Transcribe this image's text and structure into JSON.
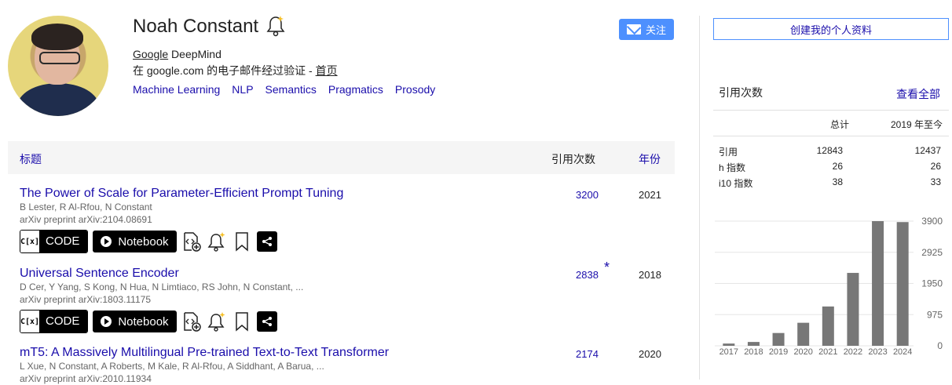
{
  "profile": {
    "name": "Noah Constant",
    "affiliation_link": "Google",
    "affiliation_rest": " DeepMind",
    "verified_prefix": "在 google.com 的电子邮件经过验证 - ",
    "homepage_label": "首页",
    "interests": [
      "Machine Learning",
      "NLP",
      "Semantics",
      "Pragmatics",
      "Prosody"
    ],
    "follow_label": "关注"
  },
  "table": {
    "col_title": "标题",
    "col_cites": "引用次数",
    "col_year": "年份"
  },
  "articles": [
    {
      "title": "The Power of Scale for Parameter-Efficient Prompt Tuning",
      "authors": "B Lester, R Al-Rfou, N Constant",
      "venue": "arXiv preprint arXiv:2104.08691",
      "cites": "3200",
      "year": "2021",
      "star": "",
      "code_label": "CODE",
      "notebook_label": "Notebook"
    },
    {
      "title": "Universal Sentence Encoder",
      "authors": "D Cer, Y Yang, S Kong, N Hua, N Limtiaco, RS John, N Constant, ...",
      "venue": "arXiv preprint arXiv:1803.11175",
      "cites": "2838",
      "year": "2018",
      "star": "*",
      "code_label": "CODE",
      "notebook_label": "Notebook"
    },
    {
      "title": "mT5: A Massively Multilingual Pre-trained Text-to-Text Transformer",
      "authors": "L Xue, N Constant, A Roberts, M Kale, R Al-Rfou, A Siddhant, A Barua, ...",
      "venue": "arXiv preprint arXiv:2010.11934",
      "cites": "2174",
      "year": "2020",
      "star": ""
    }
  ],
  "code_logo": "C[x]",
  "sidebar": {
    "create_profile_label": "创建我的个人资料",
    "cited_by_title": "引用次数",
    "view_all_label": "查看全部",
    "col_total": "总计",
    "col_since": "2019 年至今",
    "rows": [
      {
        "label": "引用",
        "total": "12843",
        "since": "12437"
      },
      {
        "label": "h 指数",
        "total": "26",
        "since": "26"
      },
      {
        "label": "i10 指数",
        "total": "38",
        "since": "33"
      }
    ]
  },
  "chart_data": {
    "type": "bar",
    "categories": [
      "2017",
      "2018",
      "2019",
      "2020",
      "2021",
      "2022",
      "2023",
      "2024"
    ],
    "values": [
      70,
      120,
      400,
      720,
      1230,
      2280,
      3900,
      3870
    ],
    "yticks": [
      "0",
      "975",
      "1950",
      "2925",
      "3900"
    ],
    "ylim": [
      0,
      3900
    ],
    "grid": true,
    "bar_color": "#777777"
  },
  "colors": {
    "link": "#1a0dab",
    "accent": "#4d90fe"
  }
}
